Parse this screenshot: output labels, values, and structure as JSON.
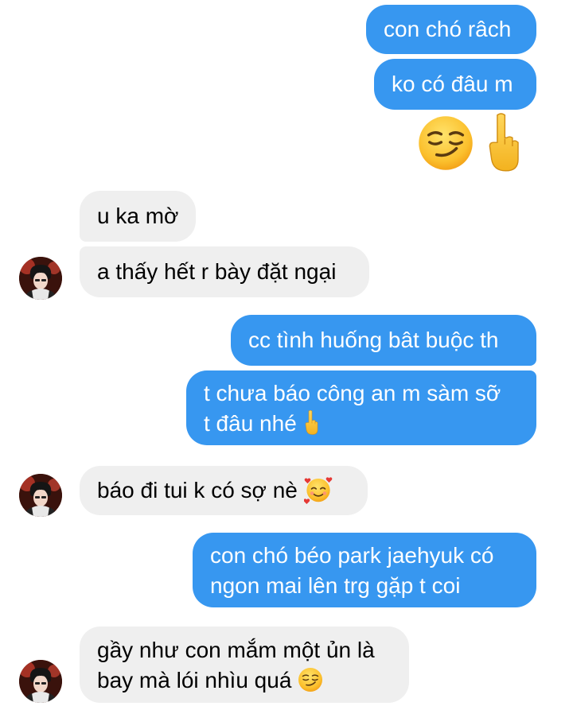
{
  "messages": {
    "m1": "con chó râch",
    "m2": "ko có đâu m",
    "m3_emoji": [
      "smirking-face",
      "middle-finger"
    ],
    "m4": "u ka mờ",
    "m5": "a thấy hết r bày đặt ngại",
    "m6": "cc tình huống bât buộc th",
    "m7_line1": "t chưa báo công an m sàm sỡ",
    "m7_line2": "t đâu nhé",
    "m7_emoji": "middle-finger",
    "m8": "báo đi tui k có sợ nè",
    "m8_emoji": "smiling-face-with-hearts",
    "m9_line1": "con chó béo park jaehyuk có",
    "m9_line2": "ngon mai lên trg gặp t coi",
    "m10_line1": "gầy như con mắm một ủn là",
    "m10_line2": "bay mà lói nhìu quá",
    "m10_emoji": "smirking-face"
  },
  "colors": {
    "outgoing": "#3797f0",
    "incoming": "#efefef"
  }
}
